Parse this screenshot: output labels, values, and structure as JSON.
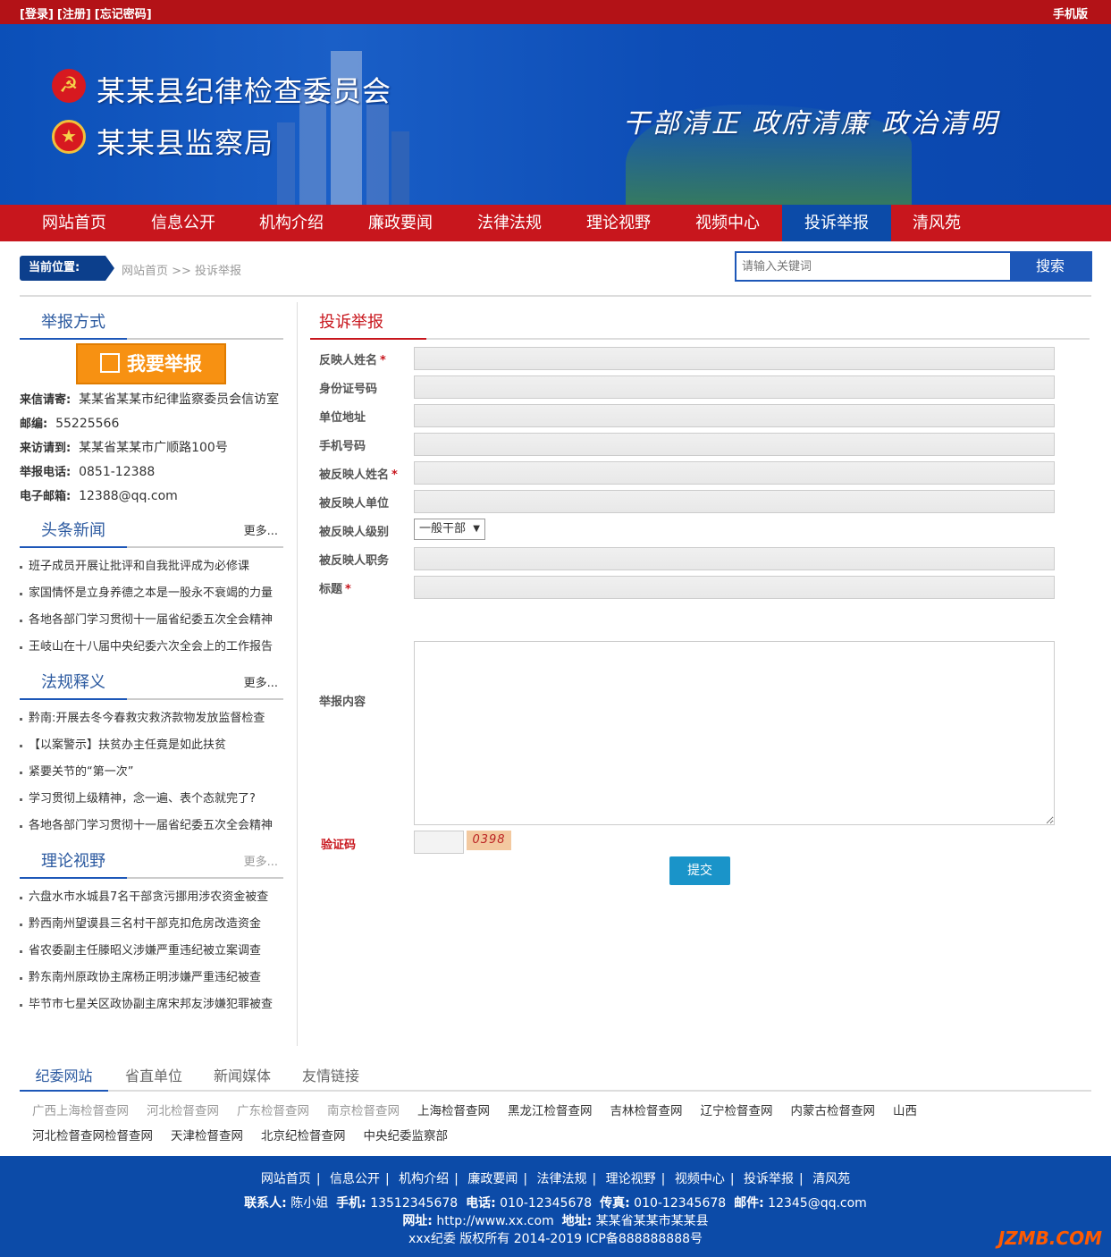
{
  "topbar": {
    "login": "[登录]",
    "register": "[注册]",
    "forgot": "[忘记密码]",
    "mobile": "手机版"
  },
  "banner": {
    "title1": "某某县纪律检查委员会",
    "title2": "某某县监察局",
    "slogan": "干部清正 政府清廉 政治清明"
  },
  "nav": [
    "网站首页",
    "信息公开",
    "机构介绍",
    "廉政要闻",
    "法律法规",
    "理论视野",
    "视频中心",
    "投诉举报",
    "清风苑"
  ],
  "location": {
    "label": "当前位置:",
    "crumb": "网站首页 >> 投诉举报"
  },
  "search": {
    "placeholder": "请输入关键词",
    "button": "搜索"
  },
  "sidebar": {
    "report_title": "举报方式",
    "report_button": "我要举报",
    "contact": [
      {
        "k": "来信请寄:",
        "v": "某某省某某市纪律监察委员会信访室"
      },
      {
        "k": "邮编:",
        "v": "55225566"
      },
      {
        "k": "来访请到:",
        "v": "某某省某某市广顺路100号"
      },
      {
        "k": "举报电话:",
        "v": "0851-12388"
      },
      {
        "k": "电子邮箱:",
        "v": "12388@qq.com"
      }
    ],
    "headline": {
      "title": "头条新闻",
      "more": "更多...",
      "items": [
        "班子成员开展让批评和自我批评成为必修课",
        "家国情怀是立身养德之本是一股永不衰竭的力量",
        "各地各部门学习贯彻十一届省纪委五次全会精神",
        "王岐山在十八届中央纪委六次全会上的工作报告"
      ]
    },
    "law": {
      "title": "法规释义",
      "more": "更多...",
      "items": [
        "黔南:开展去冬今春救灾救济款物发放监督检查",
        "【以案警示】扶贫办主任竟是如此扶贫",
        "紧要关节的“第一次”",
        "学习贯彻上级精神，念一遍、表个态就完了?",
        "各地各部门学习贯彻十一届省纪委五次全会精神"
      ]
    },
    "theory": {
      "title": "理论视野",
      "more": "更多...",
      "items": [
        "六盘水市水城县7名干部贪污挪用涉农资金被查",
        "黔西南州望谟县三名村干部克扣危房改造资金",
        "省农委副主任滕昭义涉嫌严重违纪被立案调查",
        "黔东南州原政协主席杨正明涉嫌严重违纪被查",
        "毕节市七星关区政协副主席宋邦友涉嫌犯罪被查"
      ]
    }
  },
  "main": {
    "title": "投诉举报",
    "fields": [
      {
        "label": "反映人姓名",
        "required": "*"
      },
      {
        "label": "身份证号码",
        "required": ""
      },
      {
        "label": "单位地址",
        "required": ""
      },
      {
        "label": "手机号码",
        "required": ""
      },
      {
        "label": "被反映人姓名",
        "required": "*"
      },
      {
        "label": "被反映人单位",
        "required": ""
      },
      {
        "label": "被反映人级别",
        "required": ""
      },
      {
        "label": "被反映人职务",
        "required": ""
      },
      {
        "label": "标题",
        "required": "*"
      }
    ],
    "level_value": "一般干部",
    "content_label": "举报内容",
    "captcha_label": "验证码",
    "captcha_text": "0398",
    "submit": "提交"
  },
  "links": {
    "tabs": [
      "纪委网站",
      "省直单位",
      "新闻媒体",
      "友情链接"
    ],
    "items": [
      {
        "t": "广西上海检督查网",
        "gray": true
      },
      {
        "t": "河北检督查网",
        "gray": true
      },
      {
        "t": "广东检督查网",
        "gray": true
      },
      {
        "t": "南京检督查网",
        "gray": true
      },
      {
        "t": "上海检督查网",
        "gray": false
      },
      {
        "t": "黑龙江检督查网",
        "gray": false
      },
      {
        "t": "吉林检督查网",
        "gray": false
      },
      {
        "t": "辽宁检督查网",
        "gray": false
      },
      {
        "t": "内蒙古检督查网",
        "gray": false
      },
      {
        "t": "山西",
        "gray": false
      },
      {
        "t": "河北检督查网检督查网",
        "gray": false
      },
      {
        "t": "天津检督查网",
        "gray": false
      },
      {
        "t": "北京纪检督查网",
        "gray": false
      },
      {
        "t": "中央纪委监察部",
        "gray": false
      }
    ]
  },
  "footer": {
    "nav": [
      "网站首页",
      "信息公开",
      "机构介绍",
      "廉政要闻",
      "法律法规",
      "理论视野",
      "视频中心",
      "投诉举报",
      "清风苑"
    ],
    "contact_k": "联系人:",
    "contact_v": "陈小姐",
    "mobile_k": "手机:",
    "mobile_v": "13512345678",
    "tel_k": "电话:",
    "tel_v": "010-12345678",
    "fax_k": "传真:",
    "fax_v": "010-12345678",
    "mail_k": "邮件:",
    "mail_v": "12345@qq.com",
    "url_k": "网址:",
    "url_v": "http://www.xx.com",
    "addr_k": "地址:",
    "addr_v": "某某省某某市某某县",
    "copyright": "xxx纪委  版权所有 2014-2019 ICP备888888888号",
    "watermark": "JZMB.COM"
  },
  "colors": {
    "red": "#c8161d",
    "blue": "#0c4ba8",
    "orange": "#f79112"
  }
}
